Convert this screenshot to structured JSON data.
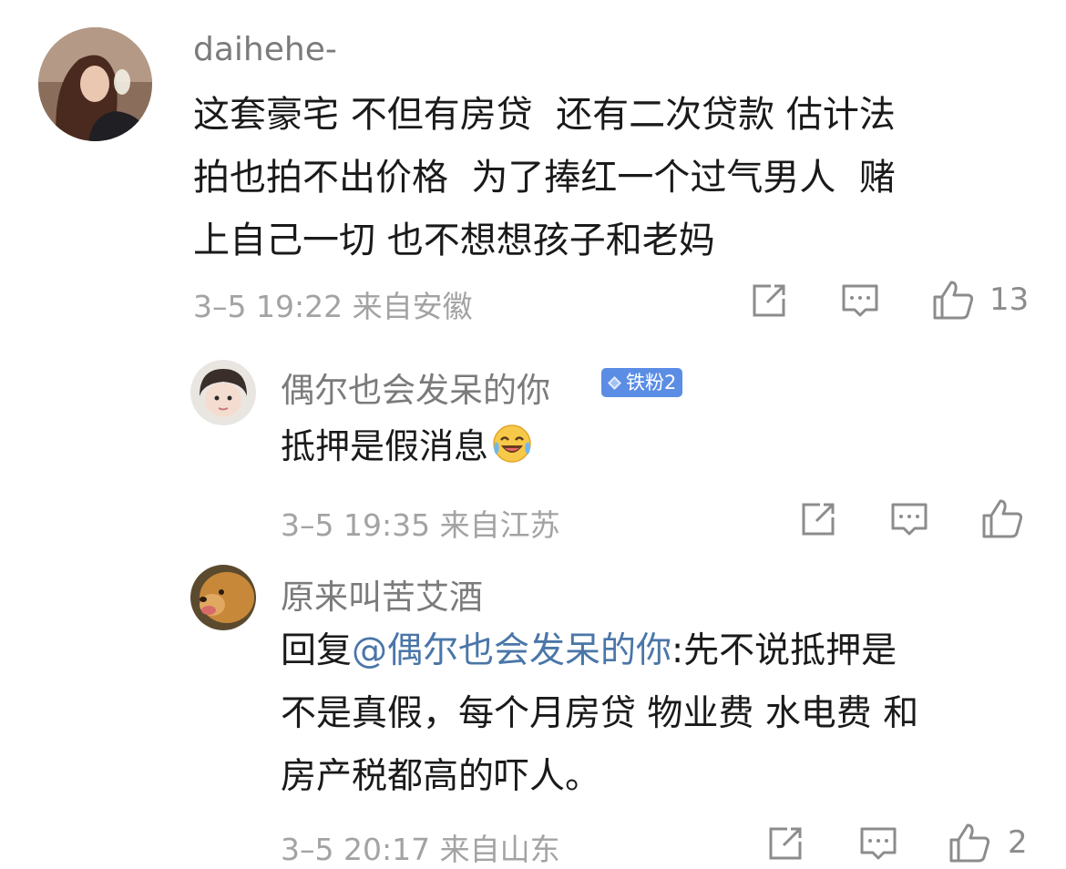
{
  "comments": [
    {
      "username": "daihehe-",
      "text": "这套豪宅 不但有房贷 还有二次贷款 估计法拍也拍不出价格 为了捧红一个过气男人 赌上自己一切 也不想想孩子和老妈",
      "lines": [
        "这套豪宅 不但有房贷  还有二次贷款 估计法",
        "拍也拍不出价格  为了捧红一个过气男人  赌",
        "上自己一切 也不想想孩子和老妈"
      ],
      "time": "3–5 19:22",
      "location": "来自安徽",
      "likes": "13"
    }
  ],
  "replies": [
    {
      "username": "偶尔也会发呆的你",
      "badge": "铁粉2",
      "text": "抵押是假消息",
      "emoji": "laughing-crying-emoji",
      "time": "3–5 19:35",
      "location": "来自江苏",
      "likes": ""
    },
    {
      "username": "原来叫苦艾酒",
      "reply_prefix": "回复",
      "mention": "@偶尔也会发呆的你",
      "text_after_mention": ":先不说抵押是",
      "lines_rest": [
        "不是真假，每个月房贷 物业费 水电费 和",
        "房产税都高的吓人。"
      ],
      "time": "3–5 20:17",
      "location": "来自山东",
      "likes": "2"
    }
  ],
  "icons": {
    "share": "share-icon",
    "comment": "comment-icon",
    "like": "thumbs-up-icon"
  },
  "colors": {
    "username": "#7b7b7b",
    "meta": "#a3a3a3",
    "mention": "#4a76a8",
    "badge": "#5b8de5"
  }
}
